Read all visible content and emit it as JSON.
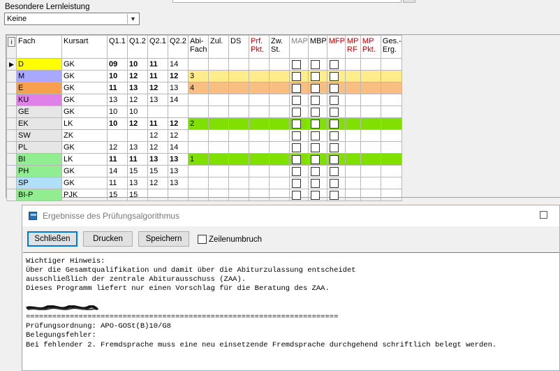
{
  "besondere_lernleistung": {
    "label": "Besondere Lernleistung",
    "selected": "Keine"
  },
  "grid": {
    "info_button": "i",
    "headers": [
      "Fach",
      "Kursart",
      "Q1.1",
      "Q1.2",
      "Q2.1",
      "Q2.2",
      "Abi-Fach",
      "Zul.",
      "DS",
      "Prf. Pkt.",
      "Zw. St.",
      "MAP",
      "MBP",
      "MFP",
      "MP RF",
      "MP Pkt.",
      "Ges.-Erg."
    ],
    "rows": [
      {
        "fach": "D",
        "kursart": "GK",
        "q11": "09",
        "q12": "10",
        "q21": "11",
        "q22": "14",
        "abi": "",
        "bold": [
          true,
          true,
          true,
          false
        ],
        "color": "#ffff00",
        "row_bg": "",
        "current": true
      },
      {
        "fach": "M",
        "kursart": "GK",
        "q11": "10",
        "q12": "12",
        "q21": "11",
        "q22": "12",
        "abi": "3",
        "bold": [
          true,
          true,
          true,
          true
        ],
        "color": "#a8a8ff",
        "row_bg": "#ffec8b",
        "current": false
      },
      {
        "fach": "E",
        "kursart": "GK",
        "q11": "11",
        "q12": "13",
        "q21": "12",
        "q22": "13",
        "abi": "4",
        "bold": [
          true,
          true,
          true,
          false
        ],
        "color": "#f8a050",
        "row_bg": "#f8c080",
        "current": false
      },
      {
        "fach": "KU",
        "kursart": "GK",
        "q11": "13",
        "q12": "12",
        "q21": "13",
        "q22": "14",
        "abi": "",
        "bold": [
          false,
          false,
          false,
          false
        ],
        "color": "#e080e8",
        "row_bg": "",
        "current": false
      },
      {
        "fach": "GE",
        "kursart": "GK",
        "q11": "10",
        "q12": "10",
        "q21": "",
        "q22": "",
        "abi": "",
        "bold": [
          false,
          false,
          false,
          false
        ],
        "color": "#e6e6e6",
        "row_bg": "",
        "current": false
      },
      {
        "fach": "EK",
        "kursart": "LK",
        "q11": "10",
        "q12": "12",
        "q21": "11",
        "q22": "12",
        "abi": "2",
        "bold": [
          true,
          true,
          true,
          true
        ],
        "color": "#e6e6e6",
        "row_bg": "#80e000",
        "current": false
      },
      {
        "fach": "SW",
        "kursart": "ZK",
        "q11": "",
        "q12": "",
        "q21": "12",
        "q22": "12",
        "abi": "",
        "bold": [
          false,
          false,
          false,
          false
        ],
        "color": "#e6e6e6",
        "row_bg": "",
        "current": false
      },
      {
        "fach": "PL",
        "kursart": "GK",
        "q11": "12",
        "q12": "13",
        "q21": "12",
        "q22": "14",
        "abi": "",
        "bold": [
          false,
          false,
          false,
          false
        ],
        "color": "#e6e6e6",
        "row_bg": "",
        "current": false
      },
      {
        "fach": "BI",
        "kursart": "LK",
        "q11": "11",
        "q12": "11",
        "q21": "13",
        "q22": "13",
        "abi": "1",
        "bold": [
          true,
          true,
          true,
          true
        ],
        "color": "#90ee90",
        "row_bg": "#80e000",
        "current": false
      },
      {
        "fach": "PH",
        "kursart": "GK",
        "q11": "14",
        "q12": "15",
        "q21": "15",
        "q22": "13",
        "abi": "",
        "bold": [
          false,
          false,
          false,
          false
        ],
        "color": "#90ee90",
        "row_bg": "",
        "current": false
      },
      {
        "fach": "SP",
        "kursart": "GK",
        "q11": "11",
        "q12": "13",
        "q21": "12",
        "q22": "13",
        "abi": "",
        "bold": [
          false,
          false,
          false,
          false
        ],
        "color": "#b0e0f8",
        "row_bg": "",
        "current": false
      },
      {
        "fach": "BI-P",
        "kursart": "PJK",
        "q11": "15",
        "q12": "15",
        "q21": "",
        "q22": "",
        "abi": "",
        "bold": [
          false,
          false,
          false,
          false
        ],
        "color": "#90ee90",
        "row_bg": "",
        "current": false
      }
    ]
  },
  "dialog": {
    "title": "Ergebnisse des Prüfungsalgorithmus",
    "buttons": {
      "close": "Schließen",
      "print": "Drucken",
      "save": "Speichern"
    },
    "wrap_label": "Zeilenumbruch",
    "lines": [
      "Wichtiger Hinweis:",
      "Über die Gesamtqualifikation und damit über die Abiturzulassung entscheidet",
      "ausschließlich der zentrale Abiturausschuss (ZAA).",
      "Dieses Programm liefert nur einen Vorschlag für die Beratung des ZAA.",
      "",
      "",
      "=======================================================================",
      "Prüfungsordnung: APO-GOSt(B)10/G8",
      "Belegungsfehler:",
      "Bei fehlender 2. Fremdsprache muss eine neu einsetzende Fremdsprache durchgehend schriftlich belegt werden."
    ]
  }
}
